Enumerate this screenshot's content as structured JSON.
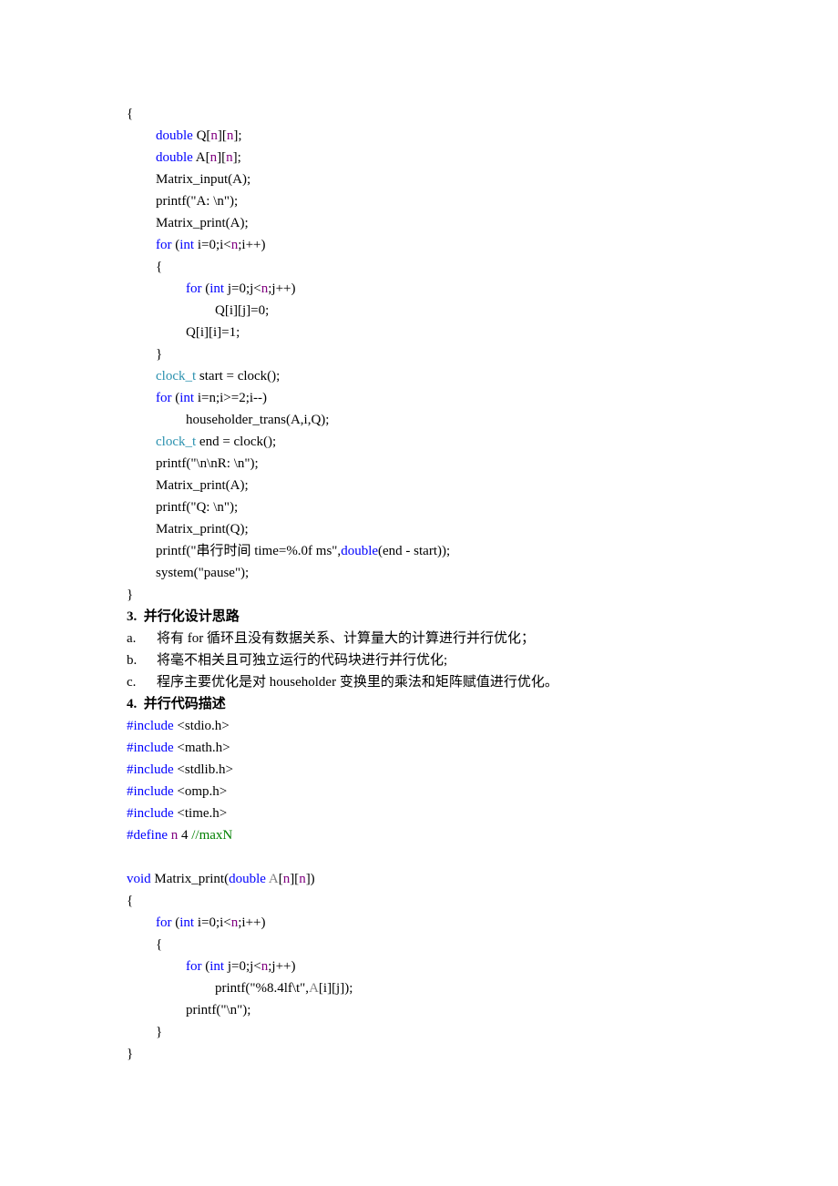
{
  "colors": {
    "keyword": "#0000ff",
    "macro": "#800080",
    "type": "#2b91af",
    "comment": "#008000",
    "param": "#808080"
  },
  "code_block_1": [
    "{",
    [
      "double",
      " Q[",
      "n",
      "][",
      "n",
      "];"
    ],
    [
      "double",
      " A[",
      "n",
      "][",
      "n",
      "];"
    ],
    "Matrix_input(A);",
    "printf(\"A: \\n\");",
    "Matrix_print(A);",
    [
      "for",
      " (",
      "int",
      " i=0;i<",
      "n",
      ";i++)"
    ],
    "{",
    [
      "for",
      " (",
      "int",
      " j=0;j<",
      "n",
      ";j++)"
    ],
    "Q[i][j]=0;",
    "Q[i][i]=1;",
    "}",
    [
      "clock_t",
      " start = clock();"
    ],
    [
      "for",
      " (",
      "int",
      " i=n;i>=2;i--)"
    ],
    "householder_trans(A,i,Q);",
    [
      "clock_t",
      " end = clock();"
    ],
    "printf(\"\\n\\nR: \\n\");",
    "Matrix_print(A);",
    "printf(\"Q: \\n\");",
    "Matrix_print(Q);",
    [
      "printf(\"串行时间 time=%.0f ms\",",
      "double",
      "(end - start));"
    ],
    "system(\"pause\");",
    "}"
  ],
  "section3": {
    "heading": "3.  并行化设计思路",
    "items": [
      {
        "label": "a.",
        "text": "将有 for 循环且没有数据关系、计算量大的计算进行并行优化；"
      },
      {
        "label": "b.",
        "text": "将毫不相关且可独立运行的代码块进行并行优化;"
      },
      {
        "label": "c.",
        "text": "程序主要优化是对 householder 变换里的乘法和矩阵赋值进行优化。"
      }
    ]
  },
  "section4": {
    "heading": "4.  并行代码描述",
    "includes": [
      [
        "#include",
        " <stdio.h>"
      ],
      [
        "#include",
        " <math.h>"
      ],
      [
        "#include",
        " <stdlib.h>"
      ],
      [
        "#include",
        " <omp.h>"
      ],
      [
        "#include",
        " <time.h>"
      ]
    ],
    "define": [
      "#define",
      " ",
      "n",
      " 4 ",
      "//maxN"
    ]
  },
  "code_block_2": {
    "signature": [
      "void",
      " Matrix_print(",
      "double",
      " ",
      "A",
      "[",
      "n",
      "][",
      "n",
      "])"
    ],
    "open": "{",
    "for_i": [
      "for",
      " (",
      "int",
      " i=0;i<",
      "n",
      ";i++)"
    ],
    "open2": "{",
    "for_j": [
      "for",
      " (",
      "int",
      " j=0;j<",
      "n",
      ";j++)"
    ],
    "printf_val": [
      "printf(\"%8.4lf\\t\",",
      "A",
      "[i][j]);"
    ],
    "printf_nl": "printf(\"\\n\");",
    "close2": "}",
    "close": "}"
  }
}
